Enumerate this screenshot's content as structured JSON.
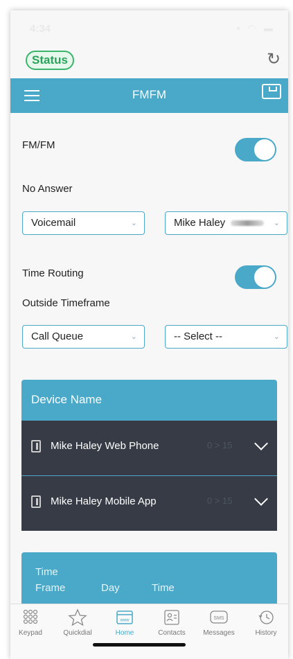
{
  "statusbar": {
    "time": "4:34",
    "icons": "signal wifi battery"
  },
  "topbar": {
    "status_label": "Status"
  },
  "navbar": {
    "title": "FMFM"
  },
  "fmfm": {
    "label": "FM/FM",
    "enabled": true
  },
  "no_answer": {
    "label": "No Answer",
    "select1": "Voicemail",
    "select2": "Mike Haley"
  },
  "time_routing": {
    "label": "Time Routing",
    "enabled": true
  },
  "outside_timeframe": {
    "label": "Outside Timeframe",
    "select1": "Call Queue",
    "select2": "-- Select --"
  },
  "devices": {
    "header": "Device Name",
    "items": [
      {
        "name": "Mike Haley Web Phone",
        "ring": "0 > 15"
      },
      {
        "name": "Mike Haley Mobile App",
        "ring": "0 > 15"
      }
    ]
  },
  "timeframe": {
    "col1_line1": "Time",
    "col1_line2": "Frame",
    "col2": "Day",
    "col3": "Time"
  },
  "tabs": [
    {
      "label": "Keypad",
      "icon": "keypad-icon"
    },
    {
      "label": "Quickdial",
      "icon": "star-icon"
    },
    {
      "label": "Home",
      "icon": "home-www-icon"
    },
    {
      "label": "Contacts",
      "icon": "contacts-icon"
    },
    {
      "label": "Messages",
      "icon": "sms-icon"
    },
    {
      "label": "History",
      "icon": "history-icon"
    }
  ],
  "colors": {
    "accent": "#4aa8c8",
    "dark_row": "#363b45",
    "status_green": "#3bb56b"
  }
}
